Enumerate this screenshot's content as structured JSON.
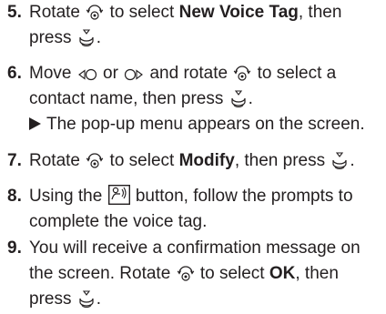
{
  "steps": [
    {
      "number": "5.",
      "parts": [
        {
          "t": "text",
          "v": "Rotate "
        },
        {
          "t": "icon",
          "v": "rotate-knob-icon"
        },
        {
          "t": "text",
          "v": " to select "
        },
        {
          "t": "bold",
          "v": "New Voice Tag"
        },
        {
          "t": "text",
          "v": ", then"
        },
        {
          "t": "br"
        },
        {
          "t": "text",
          "v": "press "
        },
        {
          "t": "icon",
          "v": "press-knob-icon"
        },
        {
          "t": "text",
          "v": "."
        }
      ]
    },
    {
      "number": "6.",
      "parts": [
        {
          "t": "text",
          "v": "Move "
        },
        {
          "t": "icon",
          "v": "move-left-icon"
        },
        {
          "t": "text",
          "v": " or "
        },
        {
          "t": "icon",
          "v": "move-right-icon"
        },
        {
          "t": "text",
          "v": " and rotate "
        },
        {
          "t": "icon",
          "v": "rotate-knob-icon"
        },
        {
          "t": "text",
          "v": " to select a"
        },
        {
          "t": "br"
        },
        {
          "t": "text",
          "v": "contact name, then press "
        },
        {
          "t": "icon",
          "v": "press-knob-icon"
        },
        {
          "t": "text",
          "v": "."
        }
      ],
      "result": "The pop-up menu appears on the screen."
    },
    {
      "number": "7.",
      "parts": [
        {
          "t": "text",
          "v": "Rotate "
        },
        {
          "t": "icon",
          "v": "rotate-knob-icon"
        },
        {
          "t": "text",
          "v": " to select "
        },
        {
          "t": "bold",
          "v": "Modify"
        },
        {
          "t": "text",
          "v": ", then press "
        },
        {
          "t": "icon",
          "v": "press-knob-icon"
        },
        {
          "t": "text",
          "v": "."
        }
      ]
    },
    {
      "number": "8.",
      "parts": [
        {
          "t": "text",
          "v": "Using the "
        },
        {
          "t": "icon",
          "v": "talk-button-icon"
        },
        {
          "t": "text",
          "v": " button, follow the prompts to"
        },
        {
          "t": "br"
        },
        {
          "t": "text",
          "v": "complete the voice tag."
        }
      ]
    },
    {
      "number": "9.",
      "parts": [
        {
          "t": "text",
          "v": "You will receive a confirmation message on"
        },
        {
          "t": "br"
        },
        {
          "t": "text",
          "v": "the screen. Rotate "
        },
        {
          "t": "icon",
          "v": "rotate-knob-icon"
        },
        {
          "t": "text",
          "v": " to select "
        },
        {
          "t": "bold",
          "v": "OK"
        },
        {
          "t": "text",
          "v": ", then"
        },
        {
          "t": "br"
        },
        {
          "t": "text",
          "v": "press "
        },
        {
          "t": "icon",
          "v": "press-knob-icon"
        },
        {
          "t": "text",
          "v": "."
        }
      ]
    }
  ]
}
